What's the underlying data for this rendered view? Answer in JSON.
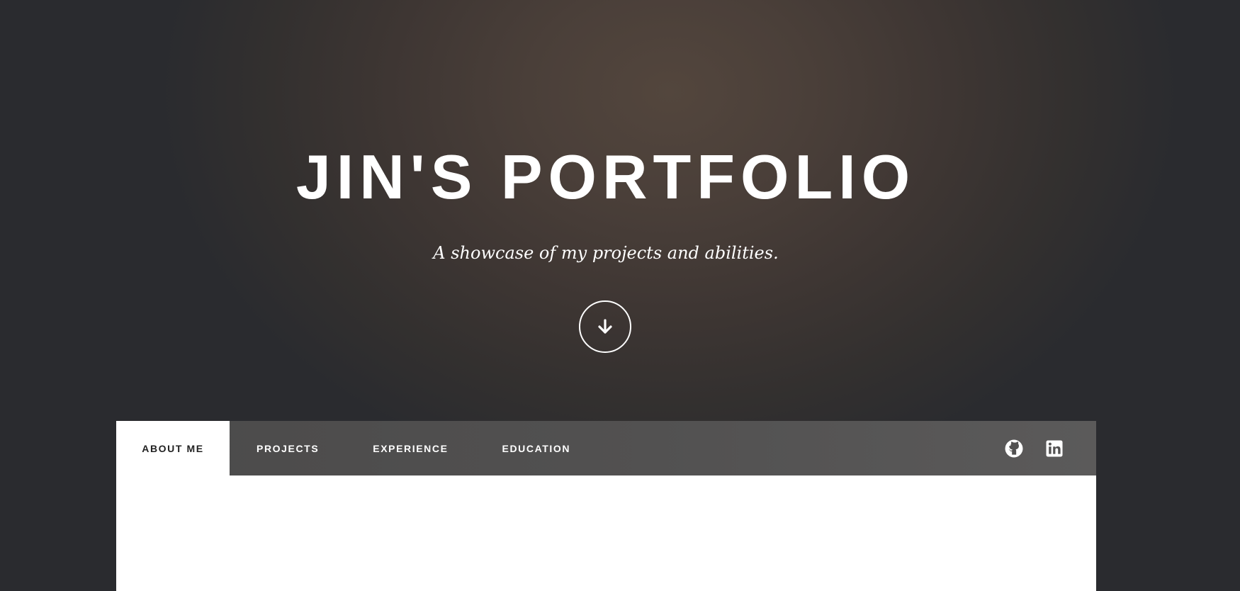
{
  "hero": {
    "title": "JIN'S PORTFOLIO",
    "subtitle": "A showcase of my projects and abilities.",
    "scroll_icon": "arrow-down-icon"
  },
  "nav": {
    "tabs": [
      {
        "label": "ABOUT ME",
        "active": true
      },
      {
        "label": "PROJECTS",
        "active": false
      },
      {
        "label": "EXPERIENCE",
        "active": false
      },
      {
        "label": "EDUCATION",
        "active": false
      }
    ],
    "social": [
      {
        "icon": "github-icon"
      },
      {
        "icon": "linkedin-icon"
      }
    ]
  },
  "colors": {
    "hero_text": "#ffffff",
    "nav_bar": "#525151",
    "active_tab": "#ffffff",
    "active_tab_text": "#222222",
    "content_panel": "#ffffff"
  }
}
